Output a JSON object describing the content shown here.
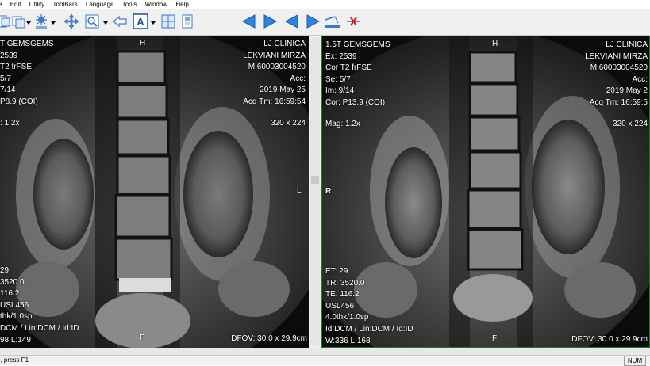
{
  "menu": [
    "e",
    "Edit",
    "Utility",
    "ToolBars",
    "Language",
    "Tools",
    "Window",
    "Help"
  ],
  "toolbar_icons": [
    "copy-icon",
    "stack-icon",
    "sun-window-icon",
    "move-icon",
    "zoom-icon",
    "arrow-left-outline-icon",
    "annotation-text-icon",
    "grid-layout-icon",
    "page-icon",
    "triangle-left-icon",
    "triangle-right-icon",
    "triangle-left-icon",
    "triangle-right-icon",
    "scan-line-icon",
    "scissors-icon"
  ],
  "left_view": {
    "top_left": [
      "T GEMSGEMS",
      "2539",
      "T2 frFSE",
      "5/7",
      "7/14",
      "P8.9 (COI)"
    ],
    "mag": ": 1.2x",
    "top_right": [
      "LJ CLINICA",
      "LEKVIANI MIRZA",
      "M  60003004520",
      "Acc:",
      "2019 May 25",
      "Acq Tm: 16:59:54"
    ],
    "matrix": "320 x 224",
    "side_right": "L",
    "top_center": "H",
    "bottom_left": [
      "29",
      "3520.0",
      "116.2",
      "USL456",
      "thk/1.0sp",
      "DCM / Lin:DCM / Id:ID",
      "98  L:149"
    ],
    "bottom_center": "F",
    "bottom_right": "DFOV: 30.0 x 29.9cm"
  },
  "right_view": {
    "top_left": [
      "1.5T GEMSGEMS",
      "Ex: 2539",
      "Cor T2 frFSE",
      "Se: 5/7",
      "Im: 9/14",
      "Cor: P13.9 (COI)"
    ],
    "mag": "Mag: 1.2x",
    "top_right": [
      "LJ CLINICA",
      "LEKVIANI MIRZA",
      "M  60003004520",
      "Acc:",
      "2019 May 2",
      "Acq Tm: 16:59:5"
    ],
    "matrix": "320 x 224",
    "side_left": "R",
    "top_center": "H",
    "bottom_left": [
      "ET: 29",
      "TR: 3520.0",
      "TE: 116.2",
      "USL456",
      "4.0thk/1.0sp",
      "Id:DCM / Lin:DCM / Id:ID",
      "W:336  L:168"
    ],
    "bottom_center": "F",
    "bottom_right": "DFOV: 30.0 x 29.9cm"
  },
  "status": {
    "text": "p, press F1",
    "num": "NUM"
  }
}
